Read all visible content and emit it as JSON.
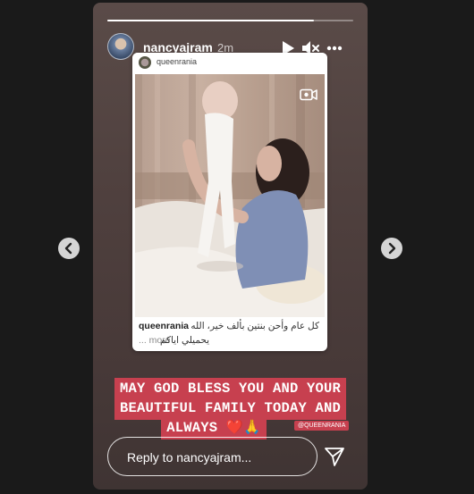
{
  "story": {
    "progress": 0.84,
    "username": "nancyajram",
    "time_ago": "2m",
    "header_icons": [
      "play-icon",
      "mute-icon",
      "more-icon"
    ]
  },
  "shared_post": {
    "username": "queenrania",
    "caption_user": "queenrania",
    "caption_line1": "كل عام وأحن بنتين بألف خير، الله",
    "caption_line2": "يحميلي اياكم",
    "caption_more": "... more",
    "media_icon": "video-camera-icon"
  },
  "banner": {
    "lines": [
      "MAY GOD BLESS YOU AND YOUR",
      "BEAUTIFUL FAMILY TODAY AND",
      "ALWAYS ❤️🙏"
    ],
    "tag": "@QUEENRANIA",
    "color": "#c7404f"
  },
  "reply": {
    "placeholder": "Reply to nancyajram...",
    "send_icon": "send-icon"
  },
  "nav": {
    "prev_icon": "chevron-left-icon",
    "next_icon": "chevron-right-icon"
  }
}
